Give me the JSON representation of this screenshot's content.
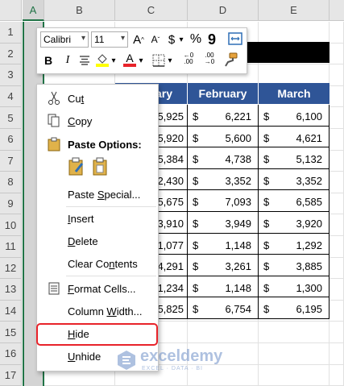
{
  "sheet": {
    "columns": [
      "A",
      "B",
      "C",
      "D",
      "E"
    ],
    "rows": [
      "1",
      "2",
      "3",
      "4",
      "5",
      "6",
      "7",
      "8",
      "9",
      "10",
      "11",
      "12",
      "13",
      "14",
      "15",
      "16",
      "17"
    ]
  },
  "table": {
    "headers": [
      "ary",
      "February",
      "March"
    ],
    "rows": [
      {
        "c": "5,925",
        "d": "6,221",
        "e": "6,100"
      },
      {
        "c": "5,920",
        "d": "5,600",
        "e": "4,621"
      },
      {
        "c": "5,384",
        "d": "4,738",
        "e": "5,132"
      },
      {
        "c": "2,430",
        "d": "3,352",
        "e": "3,352"
      },
      {
        "c": "5,675",
        "d": "7,093",
        "e": "6,585"
      },
      {
        "c": "3,910",
        "d": "3,949",
        "e": "3,920"
      },
      {
        "c": "1,077",
        "d": "1,148",
        "e": "1,292"
      },
      {
        "c": "4,291",
        "d": "3,261",
        "e": "3,885"
      },
      {
        "c": "1,234",
        "d": "1,148",
        "e": "1,300"
      },
      {
        "c": "5,825",
        "d": "6,754",
        "e": "6,195"
      }
    ],
    "currency": "$"
  },
  "mini_toolbar": {
    "font_name": "Calibri",
    "font_size": "11",
    "grow_font": "A",
    "shrink_font": "A",
    "currency_btn": "$",
    "percent_btn": "%",
    "comma_btn": "9",
    "bold": "B",
    "italic": "I",
    "font_color_letter": "A",
    "inc_decimal": "←0\n.00",
    "dec_decimal": ".00\n→0"
  },
  "context_menu": {
    "cut": "Cut",
    "copy": "Copy",
    "paste_options": "Paste Options:",
    "paste_special": "Paste Special...",
    "insert": "Insert",
    "delete": "Delete",
    "clear_contents": "Clear Contents",
    "format_cells": "Format Cells...",
    "column_width": "Column Width...",
    "hide": "Hide",
    "unhide": "Unhide"
  },
  "watermark": {
    "name": "exceldemy",
    "tagline": "EXCEL · DATA · BI"
  },
  "colors": {
    "header_blue": "#2f5597",
    "excel_green": "#217346",
    "highlight_red": "#e8232a"
  }
}
